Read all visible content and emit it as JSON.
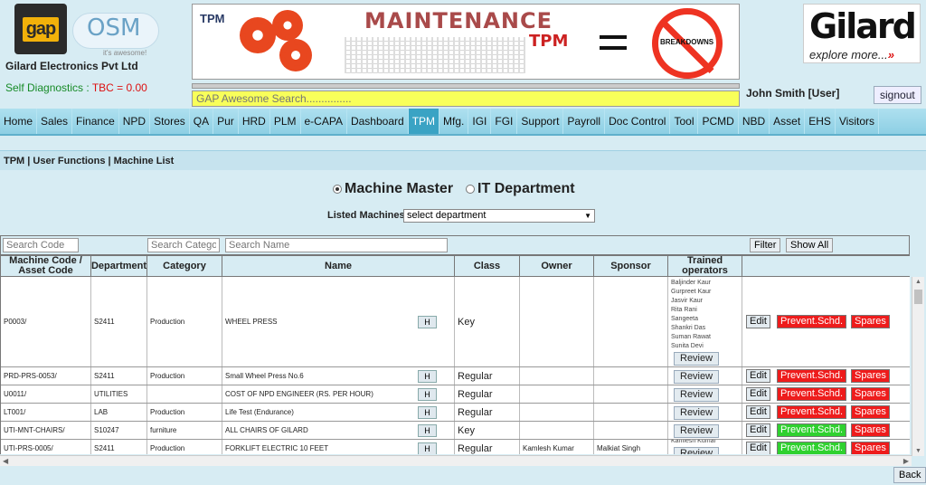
{
  "header": {
    "logo_text": "gap",
    "osm_text": "OSM",
    "osm_tagline": "it's awesome!",
    "company": "Gilard Electronics Pvt Ltd",
    "self_diag_label": "Self Diagnostics : ",
    "self_diag_value": "TBC = 0.00",
    "banner": {
      "tpm_left": "TPM",
      "maintenance": "MAINTENANCE",
      "tpm_right": "TPM",
      "breakdowns": "BREAKDOWNS"
    },
    "search_placeholder": "GAP Awesome Search...............",
    "brand": "Gilard",
    "brand_tagline": "explore more...",
    "user": "John Smith [User]",
    "signout": "signout"
  },
  "nav": {
    "items": [
      "Home",
      "Sales",
      "Finance",
      "NPD",
      "Stores",
      "QA",
      "Pur",
      "HRD",
      "PLM",
      "e-CAPA",
      "Dashboard",
      "TPM",
      "Mfg.",
      "IGI",
      "FGI",
      "Support",
      "Payroll",
      "Doc Control",
      "Tool",
      "PCMD",
      "NBD",
      "Asset",
      "EHS",
      "Visitors"
    ],
    "active": "TPM"
  },
  "breadcrumb": "TPM | User Functions | Machine List",
  "mode": {
    "options": [
      "Machine Master",
      "IT Department"
    ],
    "selected": "Machine Master"
  },
  "listed": {
    "label": "Listed Machines",
    "selected": "select department"
  },
  "filters": {
    "search_code": "Search Code",
    "search_category": "Search Category",
    "search_name": "Search Name",
    "filter": "Filter",
    "show_all": "Show All"
  },
  "table": {
    "headers": [
      "Machine Code / Asset Code",
      "Department",
      "Category",
      "Name",
      "Class",
      "Owner",
      "Sponsor",
      "Trained operators"
    ],
    "h_label": "H",
    "review_label": "Review",
    "edit_label": "Edit",
    "prevent_label": "Prevent.Schd.",
    "spares_label": "Spares",
    "rows": [
      {
        "code": "P0003/",
        "dept": "S2411",
        "category": "Production",
        "name": "WHEEL PRESS",
        "cls": "Key",
        "owner": "",
        "sponsor": "",
        "operators": [
          "Baljinder Kaur",
          "Gurpreet Kaur",
          "Jasvir Kaur",
          "Rita Rani",
          "Sangeeta",
          "Shankri Das",
          "Suman Rawat",
          "Sunita Devi"
        ],
        "prevent_status": "red"
      },
      {
        "code": "PRD-PRS-0053/",
        "dept": "S2411",
        "category": "Production",
        "name": "Small Wheel Press No.6",
        "cls": "Regular",
        "owner": "",
        "sponsor": "",
        "operators": [],
        "prevent_status": "red"
      },
      {
        "code": "U0011/",
        "dept": "UTILITIES",
        "category": "",
        "name": "COST OF NPD ENGINEER (RS. PER HOUR)",
        "cls": "Regular",
        "owner": "",
        "sponsor": "",
        "operators": [],
        "prevent_status": "red"
      },
      {
        "code": "LT001/",
        "dept": "LAB",
        "category": "Production",
        "name": "Life Test (Endurance)",
        "cls": "Regular",
        "owner": "",
        "sponsor": "",
        "operators": [],
        "prevent_status": "red"
      },
      {
        "code": "UTI-MNT-CHAIRS/",
        "dept": "S10247",
        "category": "furniture",
        "name": "ALL CHAIRS OF GILARD",
        "cls": "Key",
        "owner": "",
        "sponsor": "",
        "operators": [],
        "prevent_status": "green"
      },
      {
        "code": "UTI-PRS-0005/",
        "dept": "S2411",
        "category": "Production",
        "name": "FORKLIFT ELECTRIC 10 FEET",
        "cls": "Regular",
        "owner": "Kamlesh Kumar",
        "sponsor": "Malkiat Singh",
        "operators": [
          "Kamlesh Kumar"
        ],
        "prevent_status": "green"
      }
    ]
  },
  "back": "Back",
  "colors": {
    "nav_active": "#3aa3c4",
    "prevent_red": "#ee1c1c",
    "prevent_green": "#2fd12f",
    "search_bg": "#f8ff5a"
  }
}
